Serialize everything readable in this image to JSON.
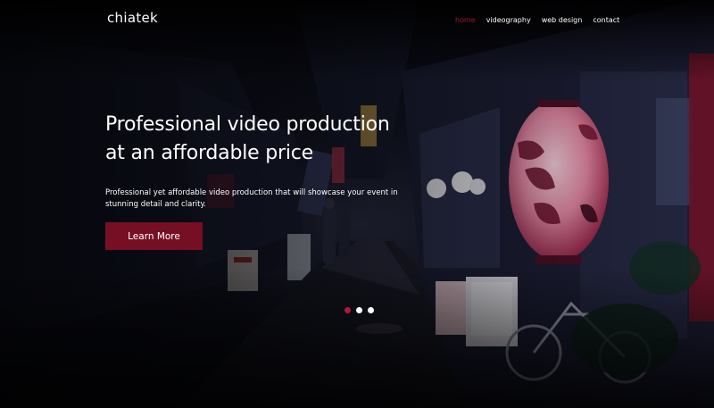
{
  "brand": {
    "logo": "chiatek"
  },
  "nav": {
    "items": [
      {
        "label": "home",
        "active": true
      },
      {
        "label": "videography",
        "active": false
      },
      {
        "label": "web design",
        "active": false
      },
      {
        "label": "contact",
        "active": false
      }
    ]
  },
  "hero": {
    "title_line1": "Professional video production",
    "title_line2": "at an affordable price",
    "subtitle": "Professional yet affordable video production that will showcase your event in stunning detail and clarity.",
    "cta_label": "Learn More"
  },
  "slider": {
    "slide_count": 3,
    "active_index": 0
  },
  "colors": {
    "accent": "#770f24",
    "accent_text": "#a4132c",
    "background": "#05060b"
  }
}
